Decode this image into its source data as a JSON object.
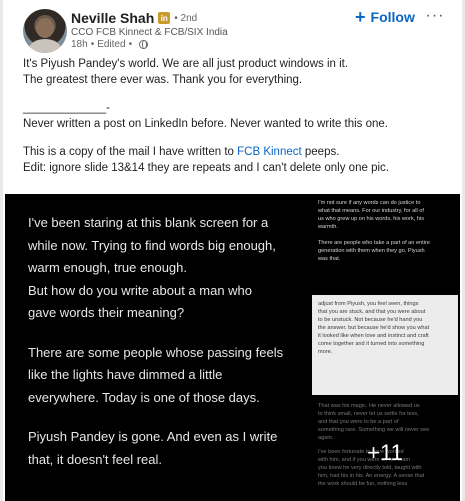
{
  "author": {
    "name": "Neville Shah",
    "badge": "in",
    "degree": "• 2nd",
    "headline": "CCO FCB Kinnect & FCB/SIX India",
    "time": "18h",
    "edited": "Edited",
    "dot": "•",
    "visibility_icon": "globe-icon"
  },
  "actions": {
    "follow_plus": "+",
    "follow_label": "Follow",
    "more_label": "···"
  },
  "post": {
    "line1": "It's Piyush Pandey's world. We are all just product windows in it.",
    "line2": "The greatest there ever was. Thank you for everything.",
    "divider": "_____________-",
    "line3": "Never written a post on LinkedIn before. Never wanted to write this one.",
    "line4_before": "This is a copy of the mail I have written to ",
    "line4_mention": "FCB Kinnect",
    "line4_after": " peeps.",
    "line5": "Edit: ignore slide 13&14 they are repeats and I can't delete only one pic."
  },
  "slide_main": {
    "l1": "I've been staring at this blank screen for a",
    "l2": "while now. Trying to find words big enough,",
    "l3": "warm enough, true enough.",
    "l4": "But how do you write about a man who",
    "l5": "gave words their meaning?",
    "l6": "There are some people whose passing feels",
    "l7": "like the lights have dimmed a little",
    "l8": "everywhere. Today is one of those days.",
    "l9": "Piyush Pandey is gone. And even as I write",
    "l10": "that, it doesn't feel real."
  },
  "thumb1": {
    "l1": "I'm not sure if any words can do justice to",
    "l2": "what that means. For our industry, for all of",
    "l3": "us who grew up on his words, his work, his",
    "l4": "warmth.",
    "l5": "There are people who take a part of an entire",
    "l6": "generation with them when they go. Piyush",
    "l7": "was that."
  },
  "thumb2": {
    "l1": "adjust from Piyush, you feel seen, things",
    "l2": "that you are stuck, and that you were about",
    "l3": "to be unstuck. Not because he'd hand you",
    "l4": "the answer, but because he'd show you what",
    "l5": "it looked like when love and instinct and craft",
    "l6": "come together and it turned into something",
    "l7": "more."
  },
  "thumb3": {
    "l1": "That was his magic. He never allowed us",
    "l2": "to think small, never let us settle for less,",
    "l3": "and that you were to be a part of",
    "l4": "something rare. Something we will never see",
    "l5": "again.",
    "l6": "I've been fortunate to have worked",
    "l7": "with him, and if you were on his team",
    "l8": "you knew he very directly told, taught with",
    "l9": "him, had his in his. An energy. A sense that",
    "l10": "the work should be fun, nothing less"
  },
  "more_count": "+11"
}
